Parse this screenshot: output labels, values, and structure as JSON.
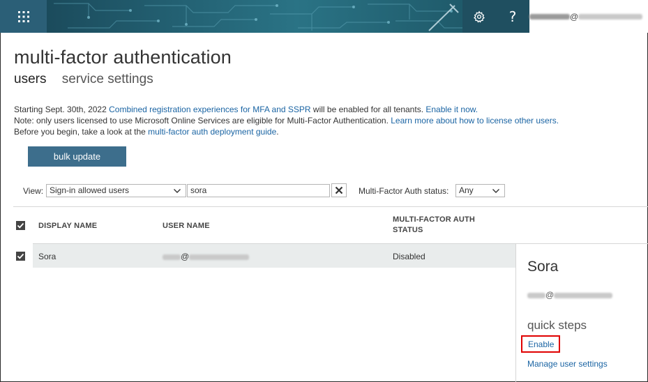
{
  "page": {
    "title": "multi-factor authentication",
    "tabs": [
      {
        "label": "users",
        "active": true
      },
      {
        "label": "service settings",
        "active": false
      }
    ]
  },
  "account": {
    "at": "@"
  },
  "notes": {
    "line1_prefix": "Starting Sept. 30th, 2022 ",
    "line1_link1": "Combined registration experiences for MFA and SSPR",
    "line1_mid": " will be enabled for all tenants. ",
    "line1_link2": "Enable it now.",
    "line2_prefix": "Note: only users licensed to use Microsoft Online Services are eligible for Multi-Factor Authentication. ",
    "line2_link": "Learn more about how to license other users.",
    "line3_prefix": "Before you begin, take a look at the ",
    "line3_link": "multi-factor auth deployment guide",
    "line3_suffix": "."
  },
  "toolbar": {
    "bulk_update_label": "bulk update"
  },
  "filters": {
    "view_label": "View:",
    "view_selected": "Sign-in allowed users",
    "search_value": "sora",
    "mfa_status_label": "Multi-Factor Auth status:",
    "mfa_status_selected": "Any"
  },
  "table": {
    "columns": [
      "DISPLAY NAME",
      "USER NAME",
      "MULTI-FACTOR AUTH",
      "STATUS"
    ],
    "rows": [
      {
        "display_name": "Sora",
        "user_name_at": "@",
        "status": "Disabled",
        "selected": true
      }
    ]
  },
  "panel": {
    "name": "Sora",
    "email_at": "@",
    "quick_steps_title": "quick steps",
    "enable_label": "Enable",
    "manage_label": "Manage user settings"
  },
  "colors": {
    "topbar": "#1e4a5c",
    "button": "#3d6e8c",
    "link": "#1a64a3",
    "highlight_box": "#e00000"
  }
}
